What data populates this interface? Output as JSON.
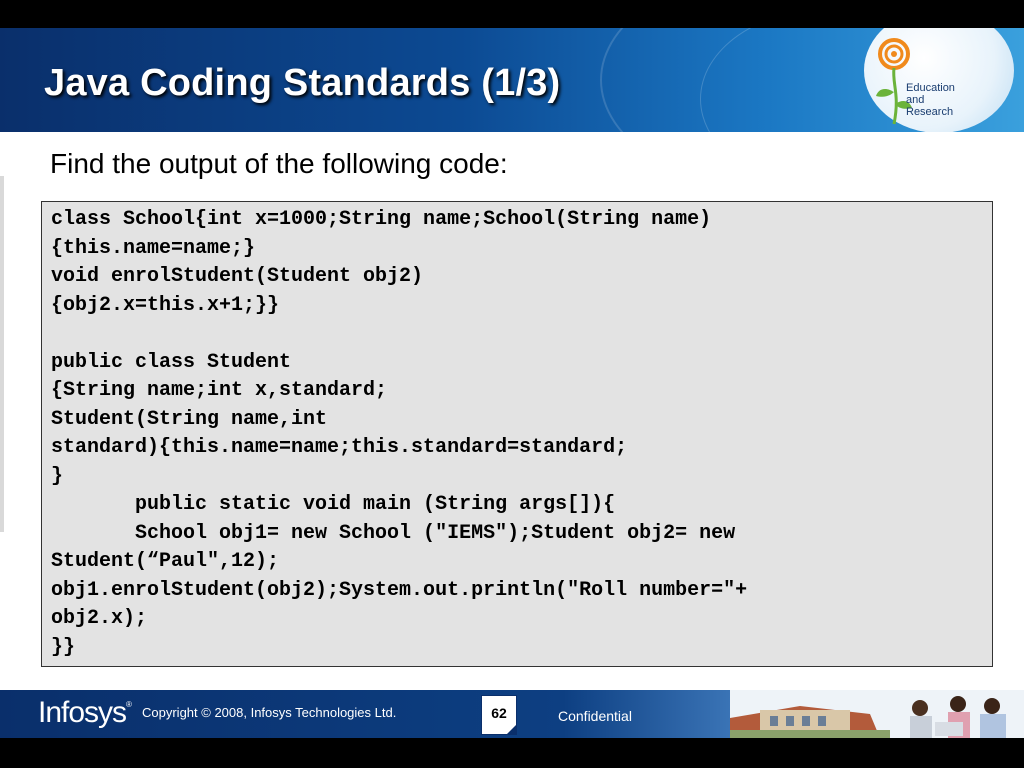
{
  "slide": {
    "title": "Java Coding Standards (1/3)",
    "logo_text": "Education and Research",
    "prompt": "Find the output of the following code:",
    "code_lines": [
      "class School{int x=1000;String name;School(String name)",
      "{this.name=name;}",
      "void enrolStudent(Student obj2)",
      "{obj2.x=this.x+1;}}",
      "",
      "public class Student",
      "{String name;int x,standard;",
      "Student(String name,int",
      "standard){this.name=name;this.standard=standard;",
      "}",
      "       public static void main (String args[]){",
      "       School obj1= new School (\"IEMS\");Student obj2= new",
      "Student(“Paul\",12);",
      "obj1.enrolStudent(obj2);System.out.println(\"Roll number=\"+",
      "obj2.x);",
      "}}"
    ]
  },
  "footer": {
    "brand": "Infosys",
    "brand_mark": "®",
    "copyright": "Copyright © 2008, Infosys Technologies Ltd.",
    "page_number": "62",
    "confidential": "Confidential"
  },
  "colors": {
    "header_dark": "#0a2f6b",
    "header_light": "#3aa0dd",
    "code_bg": "#e3e3e3",
    "logo_orange": "#f08a1c",
    "logo_green": "#6bb33a"
  },
  "icons": {
    "logo": "flower-logo-icon",
    "photo": "campus-photo"
  }
}
